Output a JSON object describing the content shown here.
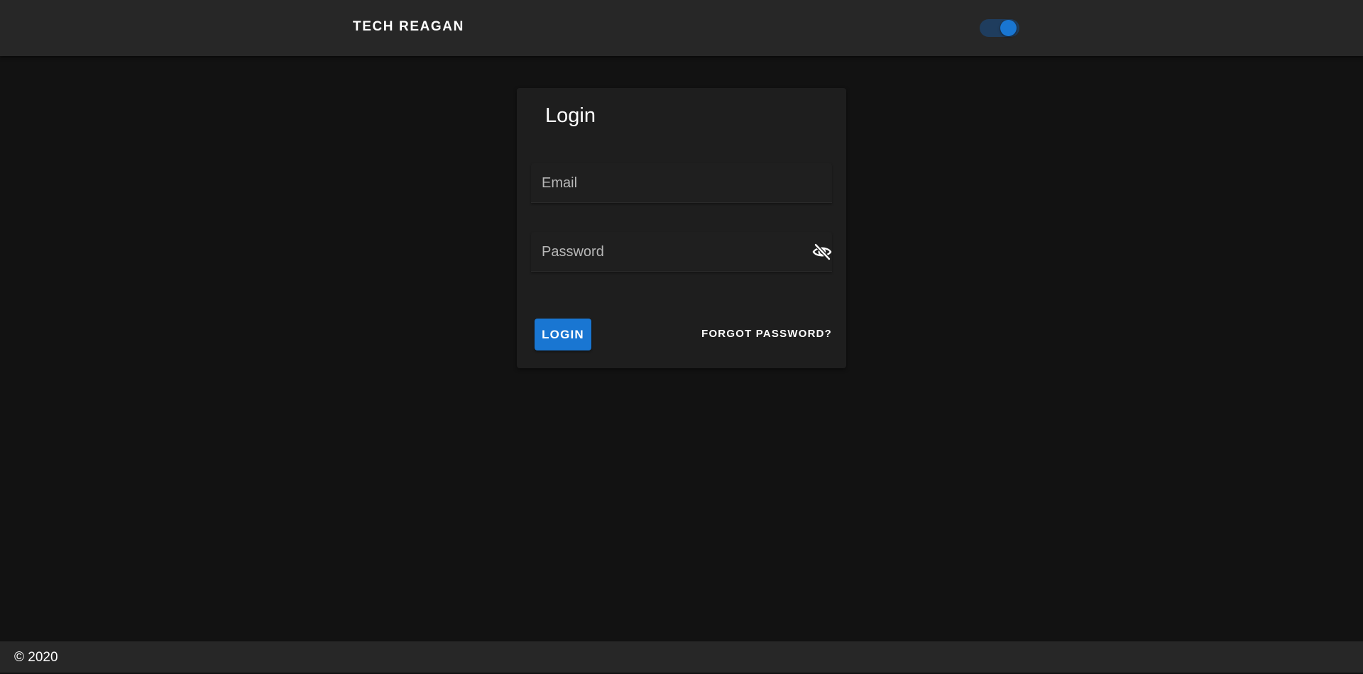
{
  "app_bar": {
    "title": "TECH REAGAN",
    "theme_toggle": {
      "on": true,
      "track_color": "#1f3d5e",
      "thumb_color": "#1976d2"
    }
  },
  "login_card": {
    "title": "Login",
    "email": {
      "value": "",
      "placeholder": "Email"
    },
    "password": {
      "value": "",
      "placeholder": "Password",
      "toggle_icon": "eye-off-icon"
    },
    "login_label": "LOGIN",
    "forgot_label": "FORGOT PASSWORD?"
  },
  "footer": {
    "text": "© 2020"
  },
  "colors": {
    "background": "#121212",
    "bar": "#272727",
    "card": "#1e1e1e",
    "accent": "#1976d2"
  }
}
